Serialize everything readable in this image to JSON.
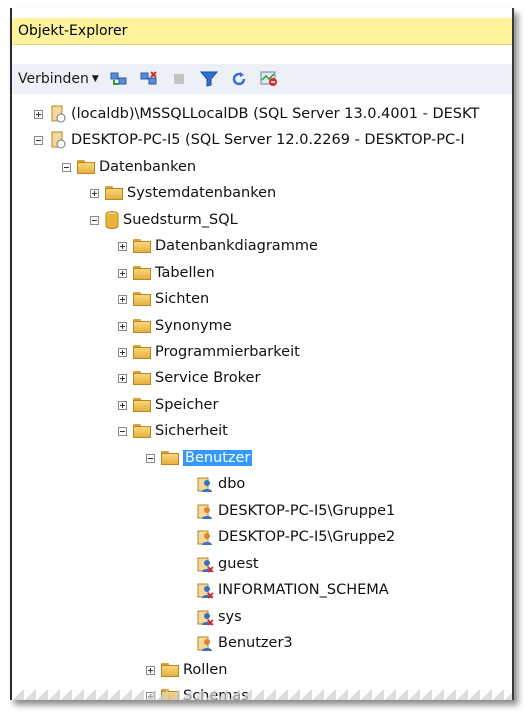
{
  "window": {
    "title": "Objekt-Explorer"
  },
  "toolbar": {
    "connect_label": "Verbinden",
    "icons": [
      "connect-object-icon",
      "disconnect-icon",
      "stop-icon",
      "filter-icon",
      "refresh-icon",
      "activity-icon"
    ]
  },
  "tree": {
    "servers": [
      {
        "label": "(localdb)\\MSSQLLocalDB (SQL Server 13.0.4001 - DESKT",
        "expanded": false
      },
      {
        "label": "DESKTOP-PC-I5 (SQL Server 12.0.2269 - DESKTOP-PC-I",
        "expanded": true
      }
    ],
    "databases_label": "Datenbanken",
    "system_db_label": "Systemdatenbanken",
    "db_label": "Suedsturm_SQL",
    "db_children": [
      "Datenbankdiagramme",
      "Tabellen",
      "Sichten",
      "Synonyme",
      "Programmierbarkeit",
      "Service Broker",
      "Speicher"
    ],
    "security_label": "Sicherheit",
    "users_label": "Benutzer",
    "users": [
      "dbo",
      "DESKTOP-PC-I5\\Gruppe1",
      "DESKTOP-PC-I5\\Gruppe2",
      "guest",
      "INFORMATION_SCHEMA",
      "sys",
      "Benutzer3"
    ],
    "roles_label": "Rollen",
    "schemas_label": "Schemas"
  }
}
